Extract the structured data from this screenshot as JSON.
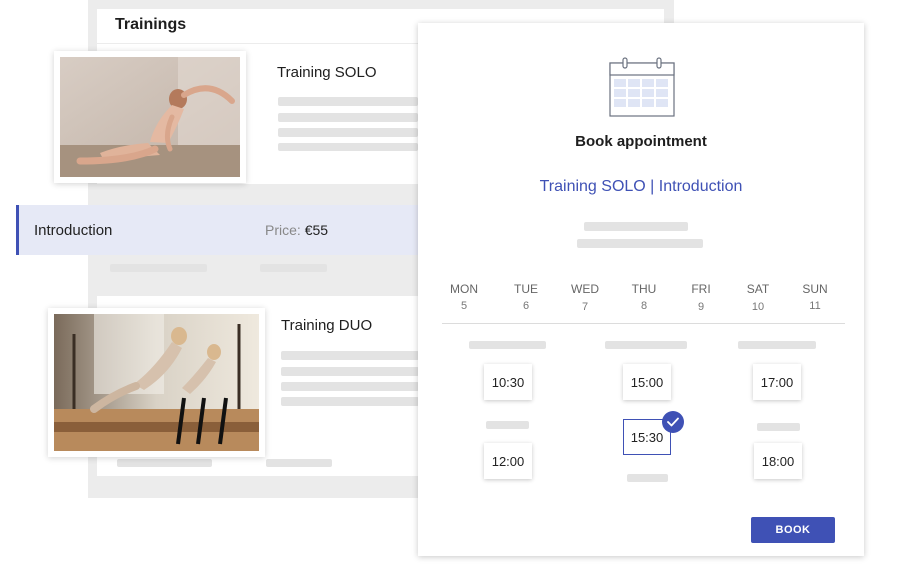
{
  "trainings_panel": {
    "title": "Trainings",
    "cards": [
      {
        "title": "Training SOLO",
        "image_alt": "Woman stretching on yoga mat"
      },
      {
        "title": "Training DUO",
        "image_alt": "Two women on pilates reformers"
      }
    ],
    "selected_row": {
      "label": "Introduction",
      "price_label": "Price:",
      "price_value": "€55"
    }
  },
  "booking": {
    "icon": "calendar-icon",
    "heading": "Book appointment",
    "subtitle": "Training SOLO | Introduction",
    "days": [
      {
        "name": "MON",
        "num": "5"
      },
      {
        "name": "TUE",
        "num": "6"
      },
      {
        "name": "WED",
        "num": "7"
      },
      {
        "name": "THU",
        "num": "8"
      },
      {
        "name": "FRI",
        "num": "9"
      },
      {
        "name": "SAT",
        "num": "10"
      },
      {
        "name": "SUN",
        "num": "11"
      }
    ],
    "slots": [
      "10:30",
      "15:00",
      "17:00",
      "15:30",
      "12:00",
      "18:00"
    ],
    "selected_slot": "15:30",
    "book_label": "BOOK"
  },
  "colors": {
    "accent": "#3f51b5",
    "selected_row_bg": "#e6e9f6",
    "panel_bg": "#ececec",
    "placeholder": "#e3e3e3"
  }
}
